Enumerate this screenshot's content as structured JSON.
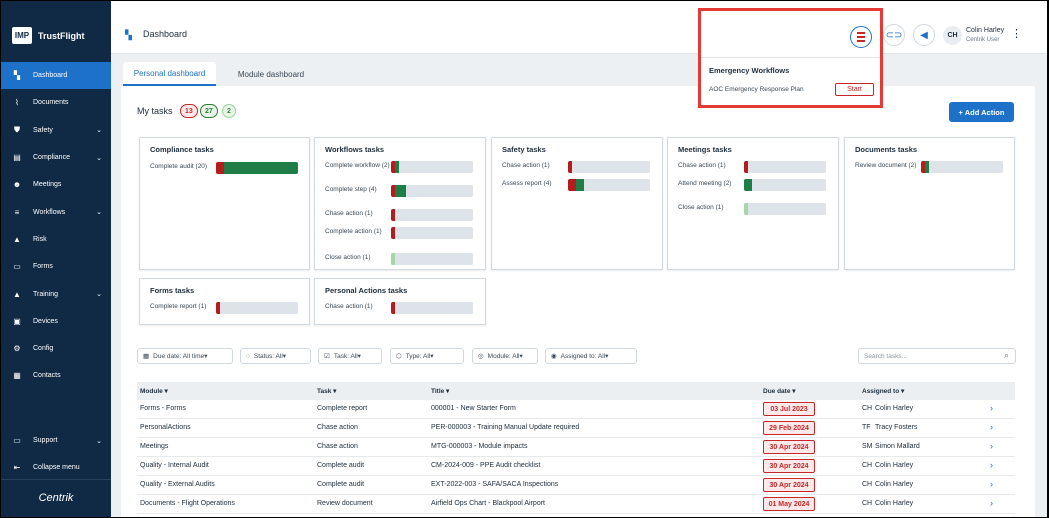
{
  "app": {
    "name": "TrustFlight",
    "logo_text": "IMP",
    "footer_brand": "Centrik"
  },
  "sidebar": {
    "items": [
      {
        "label": "Dashboard",
        "icon": "dashboard-icon",
        "active": true,
        "chevron": false
      },
      {
        "label": "Documents",
        "icon": "paperclip-icon",
        "active": false,
        "chevron": false
      },
      {
        "label": "Safety",
        "icon": "shield-icon",
        "active": false,
        "chevron": true
      },
      {
        "label": "Compliance",
        "icon": "clipboard-icon",
        "active": false,
        "chevron": true
      },
      {
        "label": "Meetings",
        "icon": "people-icon",
        "active": false,
        "chevron": false
      },
      {
        "label": "Workflows",
        "icon": "layers-icon",
        "active": false,
        "chevron": true
      },
      {
        "label": "Risk",
        "icon": "warning-icon",
        "active": false,
        "chevron": false
      },
      {
        "label": "Forms",
        "icon": "form-icon",
        "active": false,
        "chevron": false
      },
      {
        "label": "Training",
        "icon": "graduation-cap-icon",
        "active": false,
        "chevron": true
      },
      {
        "label": "Devices",
        "icon": "devices-icon",
        "active": false,
        "chevron": false
      },
      {
        "label": "Config",
        "icon": "gear-icon",
        "active": false,
        "chevron": false
      },
      {
        "label": "Contacts",
        "icon": "contacts-icon",
        "active": false,
        "chevron": false
      }
    ],
    "bottom": [
      {
        "label": "Support",
        "icon": "support-icon",
        "chevron": true
      },
      {
        "label": "Collapse menu",
        "icon": "collapse-icon",
        "chevron": false
      }
    ]
  },
  "header": {
    "title": "Dashboard",
    "user_name": "Colin Harley",
    "user_role": "Centrik User",
    "user_initials": "CH"
  },
  "tabs": [
    {
      "label": "Personal dashboard",
      "active": true
    },
    {
      "label": "Module dashboard",
      "active": false
    }
  ],
  "my_tasks": {
    "label": "My tasks",
    "counts": {
      "red": "13",
      "green": "27",
      "light": "2"
    },
    "add_action": "+ Add Action"
  },
  "cards": [
    {
      "title": "Compliance tasks",
      "rows": [
        {
          "label": "Complete audit (20)",
          "red": 0.1,
          "green": 0.9,
          "light": 0
        }
      ]
    },
    {
      "title": "Workflows tasks",
      "rows": [
        {
          "label": "Complete workflow (2)",
          "red": 0.05,
          "green": 0.05,
          "light": 0
        },
        {
          "label": "Complete step (4)",
          "red": 0.05,
          "green": 0.13,
          "light": 0
        },
        {
          "label": "Chase action (1)",
          "red": 0.05,
          "green": 0,
          "light": 0
        },
        {
          "label": "Complete action (1)",
          "red": 0.05,
          "green": 0,
          "light": 0
        },
        {
          "label": "Close action (1)",
          "red": 0,
          "green": 0,
          "light": 0.05
        }
      ]
    },
    {
      "title": "Safety tasks",
      "rows": [
        {
          "label": "Chase action (1)",
          "red": 0.05,
          "green": 0,
          "light": 0
        },
        {
          "label": "Assess report (4)",
          "red": 0.1,
          "green": 0.1,
          "light": 0
        }
      ]
    },
    {
      "title": "Meetings tasks",
      "rows": [
        {
          "label": "Chase action (1)",
          "red": 0.05,
          "green": 0,
          "light": 0
        },
        {
          "label": "Attend meeting (2)",
          "red": 0,
          "green": 0.1,
          "light": 0
        },
        {
          "label": "Close action (1)",
          "red": 0,
          "green": 0,
          "light": 0.05
        }
      ]
    },
    {
      "title": "Documents tasks",
      "rows": [
        {
          "label": "Review document (2)",
          "red": 0.05,
          "green": 0.05,
          "light": 0
        }
      ]
    },
    {
      "title": "Forms tasks",
      "rows": [
        {
          "label": "Complete report (1)",
          "red": 0.05,
          "green": 0,
          "light": 0
        }
      ]
    },
    {
      "title": "Personal Actions tasks",
      "rows": [
        {
          "label": "Chase action (1)",
          "red": 0.05,
          "green": 0,
          "light": 0
        }
      ]
    }
  ],
  "filters": [
    {
      "label": "Due date: All time",
      "icon": "calendar-icon"
    },
    {
      "label": "Status: All",
      "icon": "status-icon"
    },
    {
      "label": "Task: All",
      "icon": "task-icon"
    },
    {
      "label": "Type: All",
      "icon": "tag-icon"
    },
    {
      "label": "Module: All",
      "icon": "module-icon"
    },
    {
      "label": "Assigned to: All",
      "icon": "user-icon"
    }
  ],
  "search": {
    "placeholder": "Search tasks..."
  },
  "table": {
    "headers": [
      "Module",
      "Task",
      "Title",
      "Due date",
      "Assigned to"
    ],
    "rows": [
      {
        "module": "Forms - Forms",
        "task": "Complete report",
        "title": "000001 - New Starter Form",
        "due": "03 Jul 2023",
        "initials": "CH",
        "assignee": "Colin Harley"
      },
      {
        "module": "PersonalActions",
        "task": "Chase action",
        "title": "PER-000003 - Training Manual Update required",
        "due": "29 Feb 2024",
        "initials": "TF",
        "assignee": "Tracy Fosters"
      },
      {
        "module": "Meetings",
        "task": "Chase action",
        "title": "MTG-000003 - Module impacts",
        "due": "30 Apr 2024",
        "initials": "SM",
        "assignee": "Simon Mallard"
      },
      {
        "module": "Quality - Internal Audit",
        "task": "Complete audit",
        "title": "CM-2024-009 - PPE Audit checklist",
        "due": "30 Apr 2024",
        "initials": "CH",
        "assignee": "Colin Harley"
      },
      {
        "module": "Quality - External Audits",
        "task": "Complete audit",
        "title": "EXT-2022-003 - SAFA/SACA Inspections",
        "due": "30 Apr 2024",
        "initials": "CH",
        "assignee": "Colin Harley"
      },
      {
        "module": "Documents - Flight Operations",
        "task": "Review document",
        "title": "Airfield Ops Chart - Blackpool Airport",
        "due": "01 May 2024",
        "initials": "CH",
        "assignee": "Colin Harley"
      }
    ]
  },
  "emergency_popup": {
    "title": "Emergency Workflows",
    "item": "AOC Emergency Response Plan",
    "start": "Start"
  },
  "colors": {
    "red": "#b71c1c",
    "green": "#1e7e45",
    "light": "#a5d6a7",
    "accent": "#1e71c8",
    "sidebar": "#102a45"
  }
}
